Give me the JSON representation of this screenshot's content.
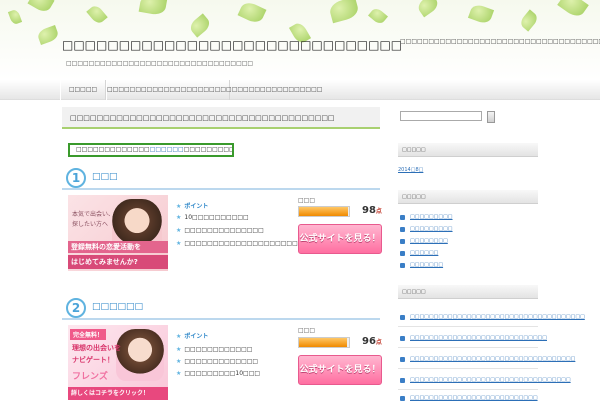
{
  "header": {
    "title": "□□□□□□□□□□□□□□□□□□□□□□□□□□□□□□",
    "description": "□□□□□□□□□□□□□□□□□□□□□□□□□□□□□□□□□",
    "right_text": "□□□□□□□□□□□□□□□□□□□□□□□□□□□□□□□□□□□□□□□"
  },
  "nav": {
    "items": [
      {
        "label": "□□□□□"
      },
      {
        "label": "□□□□□□□□□□□□□□□□□□□□□□□□□□□□□□□□□□□□□□"
      }
    ]
  },
  "post": {
    "title": "□□□□□□□□□□□□□□□□□□□□□□□□□□□□□□□□□□□□□□□□",
    "banner_prefix": "□□□□□□□□□□□□□",
    "banner_link": "□□□□□□",
    "banner_suffix": "□□□□□□□□□□□□□□□□□□□"
  },
  "rankings": [
    {
      "rank": "1",
      "name": "□□□",
      "point_label": "ポイント",
      "points": [
        "10□□□□□□□□□□",
        "□□□□□□□□□□□□□□",
        "□□□□□□□□□□□□□□□□□□□□□□"
      ],
      "score_label": "□□□",
      "score": "98",
      "score_unit": "点",
      "score_pct": 0.98,
      "button_label": "公式サイトを見る！",
      "thumb_lines": [
        "本気で出会い、",
        "探したい方へ",
        "登録無料の恋愛活動を",
        "はじめてみませんか?"
      ]
    },
    {
      "rank": "2",
      "name": "□□□□□□",
      "point_label": "ポイント",
      "points": [
        "□□□□□□□□□□□□",
        "□□□□□□□□□□□□□",
        "□□□□□□□□□10□□□"
      ],
      "score_label": "□□□",
      "score": "96",
      "score_unit": "点",
      "score_pct": 0.96,
      "button_label": "公式サイトを見る！",
      "thumb_lines": [
        "完全無料！",
        "理想の出会いを",
        "ナビゲート！",
        "フレンズ",
        "詳しくはコチラをクリック！"
      ]
    }
  ],
  "sidebar": {
    "search_placeholder": "",
    "widgets": [
      {
        "title": "□□□□□",
        "links": [
          "2014□8□"
        ]
      },
      {
        "title": "□□□□□",
        "links": [
          "□□□□□□□□□",
          "□□□□□□□□□",
          "□□□□□□□□",
          "□□□□□□",
          "□□□□□□□"
        ]
      },
      {
        "title": "□□□□□",
        "links": [
          "□□□□□□□□□□□□□□□□□□□□□□□□□□□□□□□□□□□□□",
          "□□□□□□□□□□□□□□□□□□□□□□□□□□□□□",
          "□□□□□□□□□□□□□□□□□□□□□□□□□□□□□□□□□□□",
          "□□□□□□□□□□□□□□□□□□□□□□□□□□□□□□□□□□",
          "□□□□□□□□□□□□□□□□□□□□□□□□□□□"
        ]
      }
    ]
  },
  "colors": {
    "accent_green": "#3a9a2c",
    "link_blue": "#2c6fb7",
    "rank_blue": "#4aa3d8",
    "button_pink": "#ff6fa1",
    "score_orange": "#f08a00"
  }
}
